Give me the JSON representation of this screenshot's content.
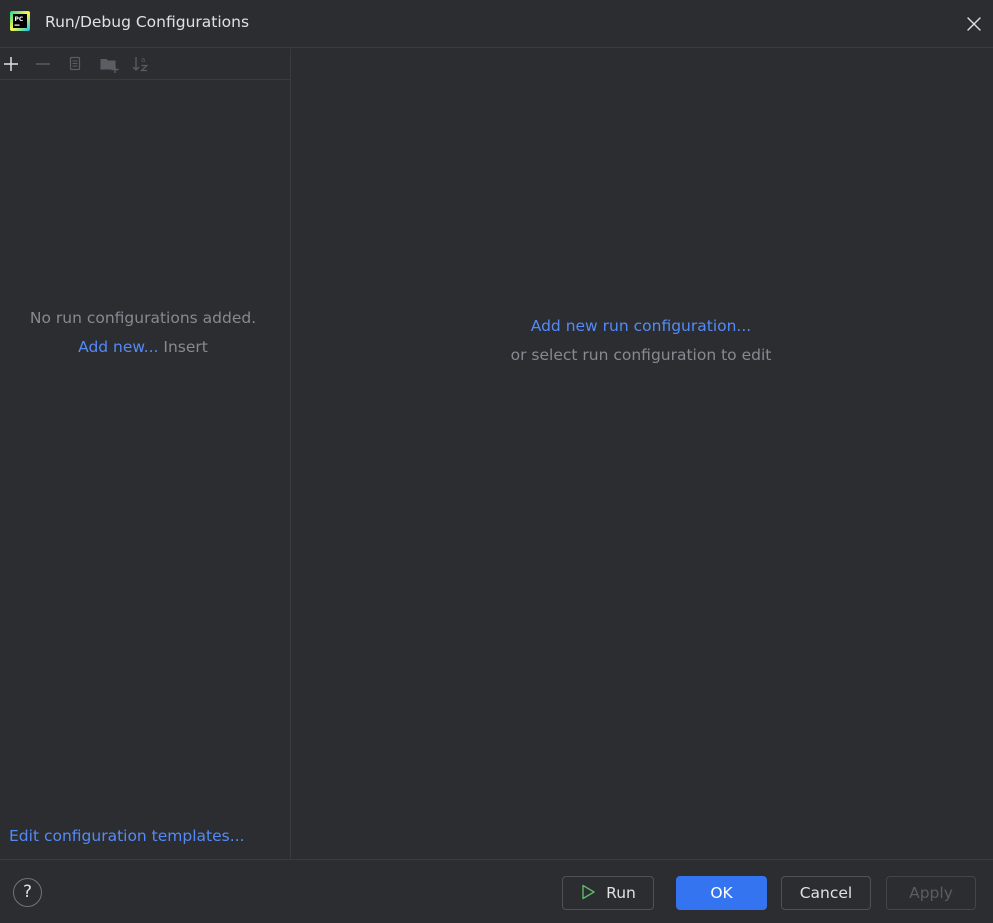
{
  "window": {
    "title": "Run/Debug Configurations",
    "logo_text": "PC"
  },
  "toolbar": {
    "items": [
      {
        "name": "add",
        "icon": "plus-icon"
      },
      {
        "name": "remove",
        "icon": "minus-icon"
      },
      {
        "name": "copy",
        "icon": "copy-icon"
      },
      {
        "name": "new-folder",
        "icon": "folder-add-icon"
      },
      {
        "name": "sort",
        "icon": "sort-alpha-icon"
      }
    ],
    "sort_glyph": "a"
  },
  "left_panel": {
    "empty_message": "No run configurations added.",
    "add_new_link": "Add new...",
    "add_new_shortcut": "Insert",
    "templates_link": "Edit configuration templates..."
  },
  "right_panel": {
    "add_link": "Add new run configuration...",
    "hint": "or select run configuration to edit"
  },
  "footer": {
    "help_label": "?",
    "run_label": "Run",
    "ok_label": "OK",
    "cancel_label": "Cancel",
    "apply_label": "Apply"
  },
  "colors": {
    "background": "#2b2d30",
    "border": "#393b40",
    "link": "#548af7",
    "muted_text": "#868a91",
    "primary_button": "#3574f0",
    "run_icon": "#5fb865"
  }
}
